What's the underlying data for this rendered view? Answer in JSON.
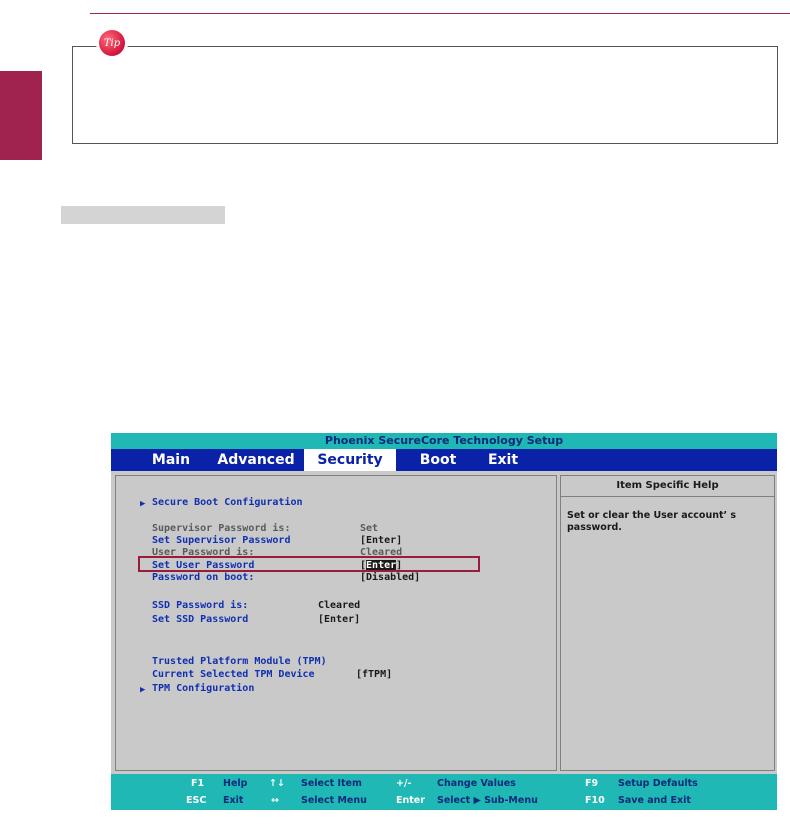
{
  "tip": {
    "badge": "Tip"
  },
  "bios": {
    "title": "Phoenix SecureCore Technology Setup",
    "menu": [
      "Main",
      "Advanced",
      "Security",
      "Boot",
      "Exit"
    ],
    "active_menu": "Security",
    "entries": {
      "secure_boot": "Secure Boot Configuration",
      "supervisor_pw_is": "Supervisor Password is:",
      "supervisor_pw_is_value": "Set",
      "set_supervisor_pw": "Set Supervisor Password",
      "set_supervisor_pw_value": "[Enter]",
      "user_pw_is": "User Password is:",
      "user_pw_is_value": "Cleared",
      "set_user_pw": "Set User Password",
      "set_user_pw_value_prefix": "[",
      "set_user_pw_value_highlight": "Enter",
      "set_user_pw_value_suffix": "]",
      "pw_on_boot": "Password on boot:",
      "pw_on_boot_value": "[Disabled]",
      "ssd_pw_is": "SSD Password is:",
      "ssd_pw_is_value": "Cleared",
      "set_ssd_pw": "Set SSD Password",
      "set_ssd_pw_value": "[Enter]",
      "tpm": "Trusted Platform Module (TPM)",
      "current_tpm": "Current Selected TPM Device",
      "current_tpm_value": "[fTPM]",
      "tpm_config": "TPM Configuration"
    },
    "help": {
      "header": "Item Specific Help",
      "text": "Set or clear the User account’ s password."
    },
    "footer": {
      "f1_key": "F1",
      "f1_label": "Help",
      "updown_key": "↑↓",
      "updown_label": "Select Item",
      "plusminus_key": "+/-",
      "plusminus_label": "Change Values",
      "f9_key": "F9",
      "f9_label": "Setup Defaults",
      "esc_key": "ESC",
      "esc_label": "Exit",
      "leftright_key": "↔",
      "leftright_label": "Select Menu",
      "enter_key": "Enter",
      "enter_label": "Select ▶ Sub-Menu",
      "f10_key": "F10",
      "f10_label": "Save and Exit"
    }
  },
  "colors": {
    "accent": "#a0224e",
    "bios_bar": "#1fb8b4",
    "bios_menu": "#0a22a8",
    "bios_text_blue": "#1030b0"
  }
}
